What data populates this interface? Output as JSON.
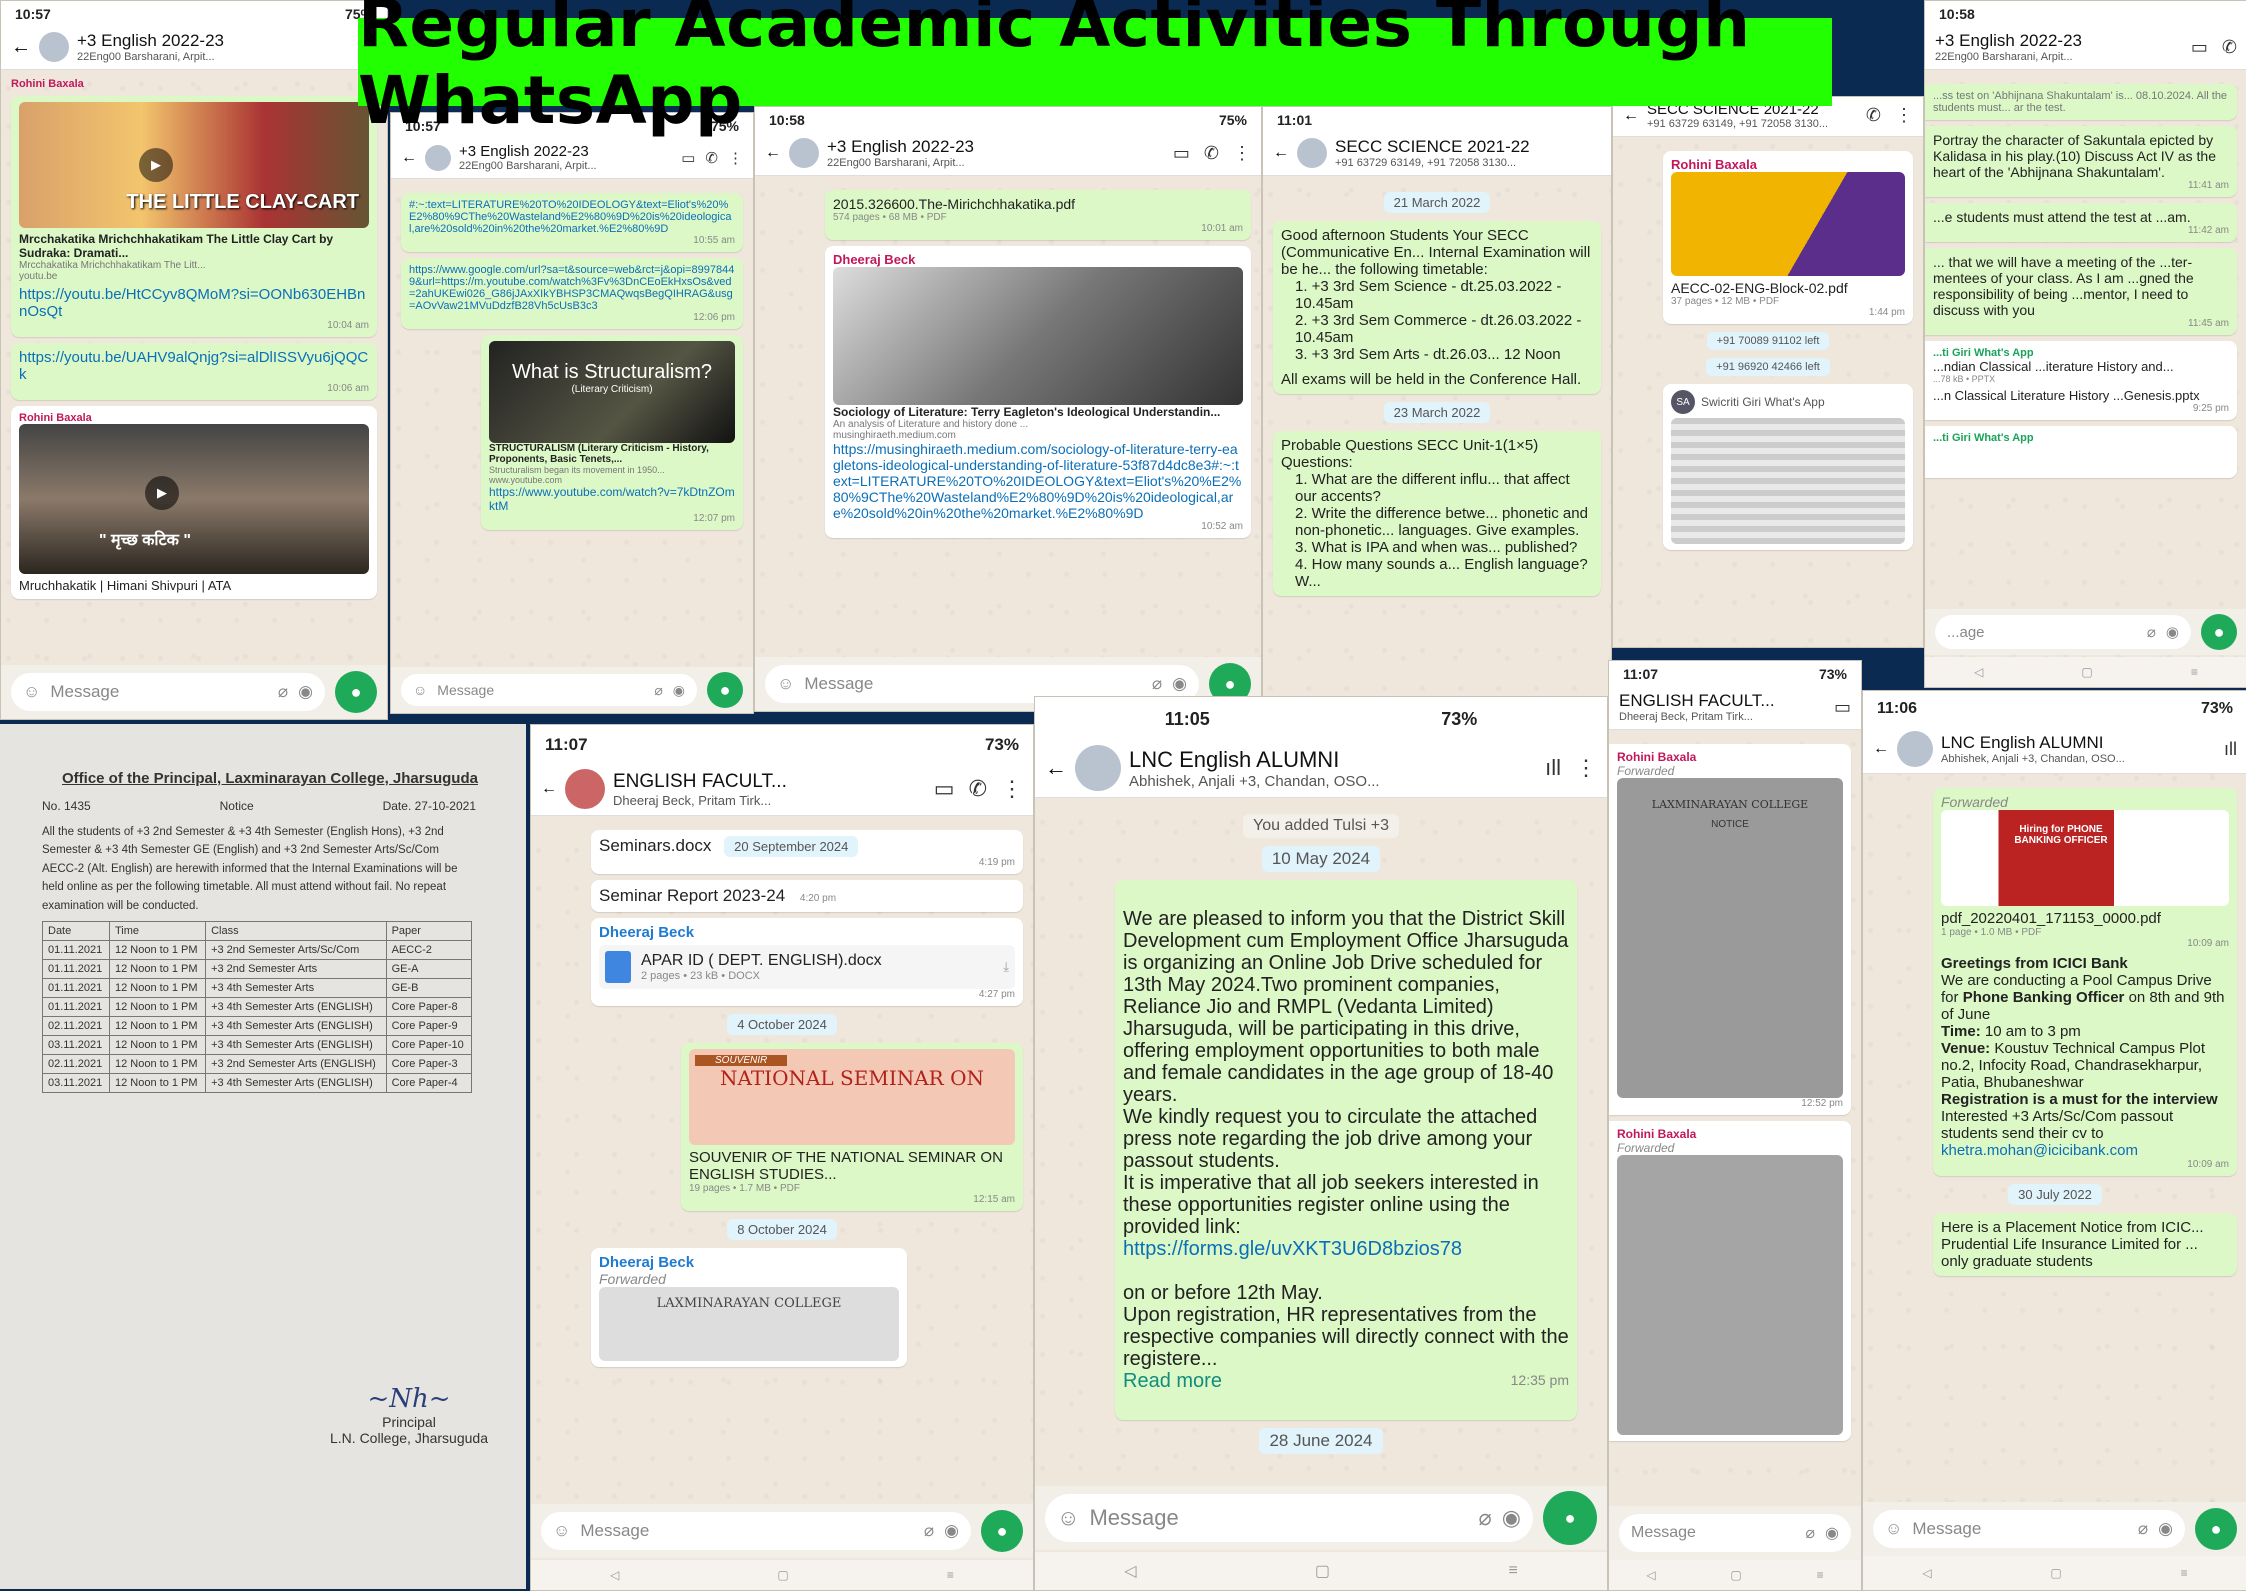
{
  "banner": {
    "title": "Regular Academic Activities Through WhatsApp"
  },
  "common": {
    "message_placeholder": "Message"
  },
  "s1": {
    "time": "10:57",
    "status_right": "75%",
    "chat_name": "+3 English 2022-23",
    "chat_sub": "22Eng00 Barsharani, Arpit...",
    "top_sender": "Rohini Baxala",
    "poster_text": "THE LITTLE CLAY-CART",
    "yt_title": "Mrcchakatika Mrichchhakatikam The Little Clay Cart by Sudraka: Dramati...",
    "yt_desc": "Mrcchakatika Mrichchhakatikam The Litt...",
    "yt_site": "youtu.be",
    "link1": "https://youtu.be/HtCCyv8QMoM?si=OONb630EHBnnOsQt",
    "time1": "10:04 am",
    "link2": "https://youtu.be/UAHV9alQnjg?si=alDlISSVyu6jQQCk",
    "time2": "10:06 am",
    "sender2": "Rohini Baxala",
    "video_caption": "\" मृच्छ कटिक \"",
    "video_title": "Mruchhakatik | Himani Shivpuri | ATA"
  },
  "s2": {
    "time": "10:57",
    "status_right": "75%",
    "chat_name": "+3 English 2022-23",
    "chat_sub": "22Eng00 Barsharani, Arpit...",
    "text1": "#:~:text=LITERATURE%20TO%20IDEOLOGY&text=Eliot's%20%E2%80%9CThe%20Wasteland%E2%80%9D%20is%20ideological,are%20sold%20in%20the%20market.%E2%80%9D",
    "time1": "10:55 am",
    "link": "https://www.google.com/url?sa=t&source=web&rct=j&opi=89978449&url=https://m.youtube.com/watch%3Fv%3DnCEoEkHxsOs&ved=2ahUKEwi026_G86jJAxXIkYBHSP3CMAQwqsBegQIHRAG&usg=AOvVaw21MVuDdzfB28Vh5cUsB3c3",
    "time2": "12:06 pm",
    "video_heading": "What is Structuralism?",
    "video_sub": "(Literary Criticism)",
    "yt_title": "STRUCTURALISM (Literary Criticism - History, Proponents, Basic Tenets,...",
    "yt_desc": "Structuralism began its movement in 1950...",
    "yt_site": "www.youtube.com",
    "yt_link": "https://www.youtube.com/watch?v=7kDtnZOmktM",
    "time3": "12:07 pm"
  },
  "s3": {
    "time": "10:58",
    "status_right": "75%",
    "chat_name": "+3 English 2022-23",
    "chat_sub": "22Eng00 Barsharani, Arpit...",
    "doc_name": "2015.326600.The-Mirichchhakatika.pdf",
    "doc_meta": "574 pages • 68 MB • PDF",
    "time1": "10:01 am",
    "sender": "Dheeraj Beck",
    "article_title": "Sociology of Literature: Terry Eagleton's Ideological Understandin...",
    "article_desc": "An analysis of Literature and history done ...",
    "article_site": "musinghiraeth.medium.com",
    "link": "https://musinghiraeth.medium.com/sociology-of-literature-terry-eagletons-ideological-understanding-of-literature-53f87d4dc8e3#:~:text=LITERATURE%20TO%20IDEOLOGY&text=Eliot's%20%E2%80%9CThe%20Wasteland%E2%80%9D%20is%20ideological,are%20sold%20in%20the%20market.%E2%80%9D",
    "time2": "10:52 am"
  },
  "s4": {
    "time": "11:01",
    "chat_name": "SECC SCIENCE 2021-22",
    "chat_sub": "+91 63729 63149, +91 72058 3130...",
    "date1": "21 March 2022",
    "msg1_intro": "Good afternoon Students Your SECC (Communicative En... Internal Examination will be he... the following timetable:",
    "msg1_items": [
      "1. +3 3rd Sem Science - dt.25.03.2022 - 10.45am",
      "2. +3 3rd Sem Commerce - dt.26.03.2022 - 10.45am",
      "3. +3 3rd Sem Arts - dt.26.03... 12 Noon"
    ],
    "msg1_footer": "All exams will be held in the Conference Hall.",
    "date2": "23 March 2022",
    "msg2_intro": "Probable Questions SECC Unit-1(1×5) Questions:",
    "msg2_items": [
      "1. What are the different influ... that affect our accents?",
      "2. Write the difference betwe... phonetic and non-phonetic... languages. Give examples.",
      "3. What is IPA and when was... published?",
      "4. How many sounds a... English language? W..."
    ]
  },
  "s5": {
    "chat_name": "SECC SCIENCE 2021-22",
    "chat_sub": "+91 63729 63149, +91 72058 3130...",
    "sender": "Rohini Baxala",
    "doc_name": "AECC-02-ENG-Block-02.pdf",
    "doc_meta": "37 pages • 12 MB • PDF",
    "time1": "1:44 pm",
    "sys1": "+91 70089 91102 left",
    "sys2": "+91 96920 42466 left",
    "sender2": "Swicriti Giri What's App",
    "sender2_initials": "SA"
  },
  "s6": {
    "time": "10:58",
    "chat_name": "+3 English 2022-23",
    "chat_sub": "22Eng00 Barsharani, Arpit...",
    "msg1": "...ss test on 'Abhijnana Shakuntalam' is... 08.10.2024. All the students must... ar the test.",
    "msg2": "Portray the character of Sakuntala epicted by Kalidasa in his play.(10) Discuss Act IV as the heart of the 'Abhijnana Shakuntalam'.",
    "time2": "11:41 am",
    "msg3": "...e students must attend the test at ...am.",
    "time3": "11:42 am",
    "msg4": "... that we will have a meeting of the ...ter-mentees of your class. As I am ...gned the responsibility of being ...mentor, I need to discuss with you",
    "time4": "11:45 am",
    "sender": "...ti Giri What's App",
    "doc1": "...ndian Classical ...iterature History and...",
    "doc1_meta": "...78 kB • PPTX",
    "msg5": "...n Classical Literature History ...Genesis.pptx",
    "time5": "9:25 pm",
    "sender2": "...ti Giri What's App",
    "placeholder": "...age"
  },
  "notice": {
    "heading": "Office of the Principal, Laxminarayan College, Jharsuguda",
    "no": "No. 1435",
    "label": "Notice",
    "date": "Date. 27-10-2021",
    "body": "All the students of +3 2nd Semester & +3 4th Semester (English Hons), +3 2nd Semester & +3 4th Semester GE (English) and +3 2nd Semester Arts/Sc/Com AECC-2 (Alt. English) are herewith informed that the Internal Examinations will be held online as per the following timetable. All must attend without fail. No repeat examination will be conducted.",
    "headers": [
      "Date",
      "Time",
      "Class",
      "Paper"
    ],
    "rows": [
      [
        "01.11.2021",
        "12 Noon to 1 PM",
        "+3 2nd Semester Arts/Sc/Com",
        "AECC-2"
      ],
      [
        "01.11.2021",
        "12 Noon to 1 PM",
        "+3 2nd Semester Arts",
        "GE-A"
      ],
      [
        "01.11.2021",
        "12 Noon to 1 PM",
        "+3 4th Semester Arts",
        "GE-B"
      ],
      [
        "01.11.2021",
        "12 Noon to 1 PM",
        "+3 4th Semester Arts (ENGLISH)",
        "Core Paper-8"
      ],
      [
        "02.11.2021",
        "12 Noon to 1 PM",
        "+3 4th Semester Arts (ENGLISH)",
        "Core Paper-9"
      ],
      [
        "03.11.2021",
        "12 Noon to 1 PM",
        "+3 4th Semester Arts (ENGLISH)",
        "Core Paper-10"
      ],
      [
        "02.11.2021",
        "12 Noon to 1 PM",
        "+3 2nd Semester Arts (ENGLISH)",
        "Core Paper-3"
      ],
      [
        "03.11.2021",
        "12 Noon to 1 PM",
        "+3 4th Semester Arts (ENGLISH)",
        "Core Paper-4"
      ]
    ],
    "sign_title": "Principal",
    "sign_college": "L.N. College, Jharsuguda"
  },
  "s7": {
    "time": "11:07",
    "status_right": "73%",
    "chat_name": "ENGLISH FACULT...",
    "chat_sub": "Dheeraj Beck, Pritam Tirk...",
    "msg1": "Seminars.docx",
    "date1": "20 September 2024",
    "time1": "4:19 pm",
    "msg2": "Seminar Report 2023-24",
    "time2": "4:20 pm",
    "sender": "Dheeraj Beck",
    "doc_name": "APAR ID ( DEPT. ENGLISH).docx",
    "doc_meta": "2 pages • 23 kB • DOCX",
    "time3": "4:27 pm",
    "date2": "4 October 2024",
    "souvenir_tag": "SOUVENIR",
    "souvenir_title": "NATIONAL SEMINAR ON",
    "souvenir_doc": "SOUVENIR OF THE NATIONAL SEMINAR ON ENGLISH STUDIES...",
    "souvenir_meta": "19 pages • 1.7 MB • PDF",
    "time4": "12:15 am",
    "date3": "8 October 2024",
    "sender2": "Dheeraj Beck",
    "forwarded": "Forwarded",
    "letterhead": "LAXMINARAYAN COLLEGE"
  },
  "s8": {
    "time": "11:05",
    "status_right": "73%",
    "chat_name": "LNC English ALUMNI",
    "chat_sub": "Abhishek, Anjali +3, Chandan, OSO...",
    "sys": "You added Tulsi +3",
    "date1": "10 May 2024",
    "msg": "We are pleased to inform you that the District Skill Development cum Employment Office Jharsuguda is organizing an Online Job Drive scheduled for 13th May 2024.Two prominent companies, Reliance Jio and RMPL (Vedanta Limited) Jharsuguda, will be participating in this drive, offering employment opportunities to both male and female candidates in the age group of 18-40 years.\nWe kindly request you to circulate the attached press note regarding the job drive among your passout students.\nIt is imperative that all job seekers interested in these opportunities register online using the provided link:",
    "link": "https://forms.gle/uvXKT3U6D8bzios78",
    "msg_after": "on or before 12th May.\nUpon registration, HR representatives from the respective companies will directly connect with the registere...",
    "read_more": "Read more",
    "time1": "12:35 pm",
    "date2": "28 June 2024"
  },
  "s9": {
    "time": "11:07",
    "status_right": "73%",
    "chat_name": "ENGLISH FACULT...",
    "chat_sub": "Dheeraj Beck, Pritam Tirk...",
    "sender": "Rohini Baxala",
    "forwarded": "Forwarded",
    "letterhead": "LAXMINARAYAN COLLEGE",
    "notice": "NOTICE",
    "time1": "12:52 pm",
    "sender2": "Rohini Baxala",
    "forwarded2": "Forwarded",
    "placeholder": "Message"
  },
  "s10": {
    "time": "11:06",
    "status_right": "73%",
    "chat_name": "LNC English ALUMNI",
    "chat_sub": "Abhishek, Anjali +3, Chandan, OSO...",
    "forwarded": "Forwarded",
    "poster_text": "Hiring for PHONE BANKING OFFICER",
    "doc_name": "pdf_20220401_171153_0000.pdf",
    "doc_meta": "1 page • 1.0 MB • PDF",
    "time1": "10:09 am",
    "greet": "Greetings from ICICI Bank",
    "line1": "We are conducting a Pool Campus Drive for",
    "line1b": "Phone Banking Officer",
    "line1c": "on 8th and 9th of June",
    "time_label": "Time:",
    "time_val": "10 am to 3 pm",
    "venue_label": "Venue:",
    "venue_val": "Koustuv Technical Campus Plot no.2, Infocity Road, Chandrasekharpur, Patia, Bhubaneshwar",
    "reg": "Registration is a must for the interview",
    "interest": "Interested +3 Arts/Sc/Com passout students send their cv to",
    "email": "khetra.mohan@icicibank.com",
    "time2": "10:09 am",
    "date": "30 July 2022",
    "msg2": "Here is a Placement Notice from ICIC... Prudential Life Insurance Limited for ... only graduate students"
  }
}
